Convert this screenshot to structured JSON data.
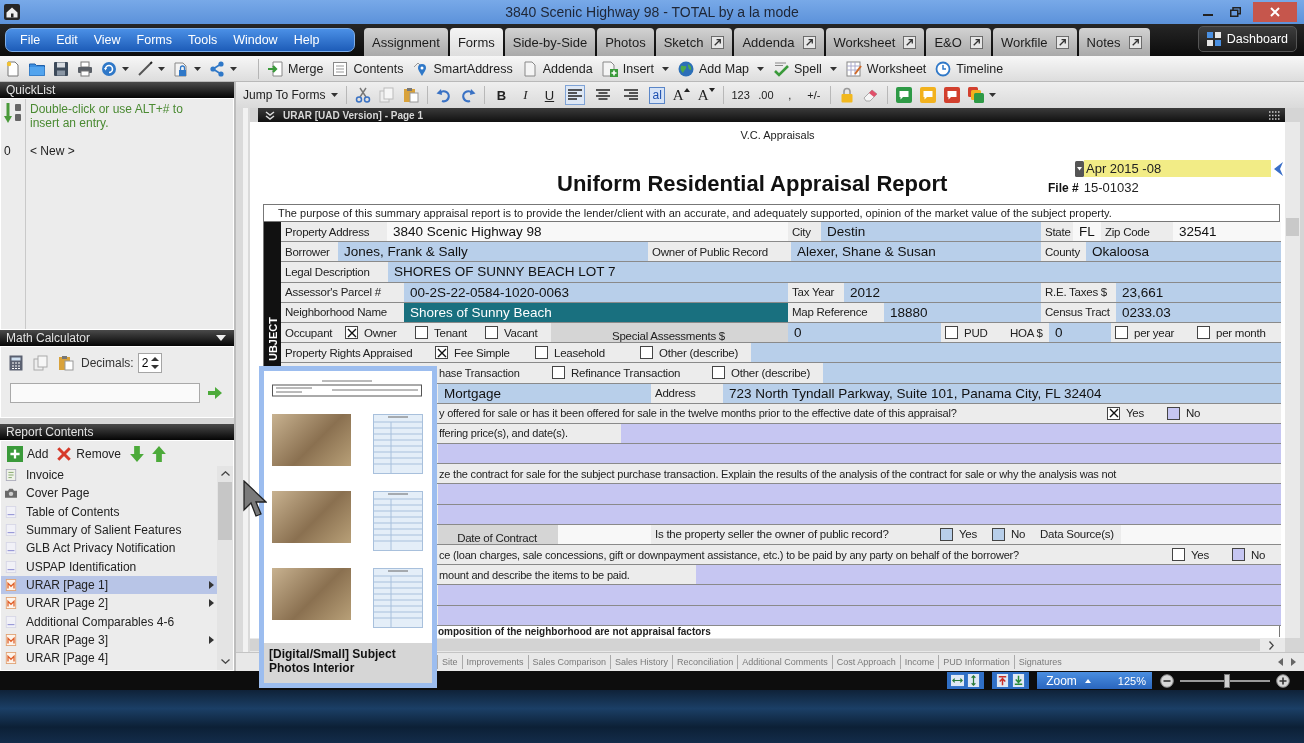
{
  "window": {
    "title": "3840 Scenic Highway 98 - TOTAL by a la mode"
  },
  "menu": [
    "File",
    "Edit",
    "View",
    "Forms",
    "Tools",
    "Window",
    "Help"
  ],
  "tabs": [
    {
      "label": "Assignment",
      "selected": false,
      "popout": false
    },
    {
      "label": "Forms",
      "selected": true,
      "popout": false
    },
    {
      "label": "Side-by-Side",
      "selected": false,
      "popout": false
    },
    {
      "label": "Photos",
      "selected": false,
      "popout": false
    },
    {
      "label": "Sketch",
      "selected": false,
      "popout": true
    },
    {
      "label": "Addenda",
      "selected": false,
      "popout": true
    },
    {
      "label": "Worksheet",
      "selected": false,
      "popout": true
    },
    {
      "label": "E&O",
      "selected": false,
      "popout": true
    },
    {
      "label": "Workfile",
      "selected": false,
      "popout": true
    },
    {
      "label": "Notes",
      "selected": false,
      "popout": true
    }
  ],
  "dashboard": {
    "label": "Dashboard"
  },
  "toolbar": {
    "buttons": [
      {
        "label": "Merge",
        "dropdown": false
      },
      {
        "label": "Contents",
        "dropdown": false
      },
      {
        "label": "SmartAddress",
        "dropdown": false
      },
      {
        "label": "Addenda",
        "dropdown": false
      },
      {
        "label": "Insert",
        "dropdown": true
      },
      {
        "label": "Add Map",
        "dropdown": true
      },
      {
        "label": "Spell",
        "dropdown": true
      },
      {
        "label": "Worksheet",
        "dropdown": false
      },
      {
        "label": "Timeline",
        "dropdown": false
      }
    ]
  },
  "format_toolbar": {
    "jump": "Jump To Forms",
    "styles": [
      "B",
      "I",
      "U"
    ],
    "align": [
      {
        "kind": "left",
        "selected": true
      },
      {
        "kind": "center",
        "selected": false
      },
      {
        "kind": "right",
        "selected": false
      }
    ],
    "font": "al",
    "sizes": [
      {
        "kind": "grow",
        "label": "A"
      },
      {
        "kind": "shrink",
        "label": "A"
      }
    ],
    "numbers": [
      "123",
      ".00",
      ",",
      "+/-"
    ]
  },
  "quicklist": {
    "title": "QuickList",
    "hint": "Double-click or use ALT+# to insert an entry.",
    "entries": [
      {
        "number": "0",
        "text": "< New >"
      }
    ]
  },
  "math_calculator": {
    "title": "Math Calculator",
    "decimals_label": "Decimals:",
    "decimals": "2"
  },
  "report_contents": {
    "title": "Report Contents",
    "add": "Add",
    "remove": "Remove",
    "items": [
      {
        "label": "Invoice",
        "kind": "invoice",
        "selected": false,
        "submenu": false
      },
      {
        "label": "Cover Page",
        "kind": "cover",
        "selected": false,
        "submenu": false
      },
      {
        "label": "Table of Contents",
        "kind": "page",
        "selected": false,
        "submenu": false
      },
      {
        "label": "Summary of Salient Features",
        "kind": "page",
        "selected": false,
        "submenu": false
      },
      {
        "label": "GLB Act Privacy Notification",
        "kind": "page",
        "selected": false,
        "submenu": false
      },
      {
        "label": "USPAP Identification",
        "kind": "page",
        "selected": false,
        "submenu": false
      },
      {
        "label": "URAR [Page 1]",
        "kind": "form",
        "selected": true,
        "submenu": true
      },
      {
        "label": "URAR [Page 2]",
        "kind": "form",
        "selected": false,
        "submenu": true
      },
      {
        "label": "Additional Comparables 4-6",
        "kind": "page",
        "selected": false,
        "submenu": false
      },
      {
        "label": "URAR [Page 3]",
        "kind": "form",
        "selected": false,
        "submenu": true
      },
      {
        "label": "URAR [Page 4]",
        "kind": "form",
        "selected": false,
        "submenu": false
      }
    ]
  },
  "document": {
    "header": "URAR [UAD Version] - Page 1",
    "company": "V.C. Appraisals",
    "date": "Apr 2015 -08",
    "title": "Uniform Residential Appraisal Report",
    "file_label": "File #",
    "file_number": "15-01032",
    "purpose": "The purpose of this summary appraisal report is to provide the lender/client with an accurate, and adequately supported, opinion of the market value of the subject property.",
    "section": "UBJECT",
    "lines": [
      {
        "parts": [
          {
            "kind": "label",
            "text": "Property Address"
          },
          {
            "kind": "value",
            "text": "3840 Scenic Highway 98",
            "selected": false
          },
          {
            "kind": "label",
            "text": "City"
          },
          {
            "kind": "value",
            "text": "Destin",
            "selected": false,
            "color": "#b8cfea"
          },
          {
            "kind": "label",
            "text": "State"
          },
          {
            "kind": "value",
            "text": "FL",
            "selected": false
          },
          {
            "kind": "label",
            "text": "Zip Code"
          },
          {
            "kind": "value",
            "text": "32541",
            "selected": false
          }
        ]
      },
      {
        "parts": [
          {
            "kind": "label",
            "text": "Borrower"
          },
          {
            "kind": "value",
            "text": "Jones, Frank & Sally",
            "selected": false,
            "color": "#b8cfea"
          },
          {
            "kind": "label",
            "text": "Owner of Public Record"
          },
          {
            "kind": "value",
            "text": "Alexer, Shane & Susan",
            "selected": false,
            "color": "#b8cfea"
          },
          {
            "kind": "label",
            "text": "County"
          },
          {
            "kind": "value",
            "text": "Okaloosa",
            "selected": false,
            "color": "#b8cfea"
          }
        ]
      },
      {
        "parts": [
          {
            "kind": "label",
            "text": "Legal Description"
          },
          {
            "kind": "value",
            "text": "SHORES OF SUNNY BEACH LOT 7",
            "selected": false,
            "color": "#b8cfea"
          }
        ]
      },
      {
        "parts": [
          {
            "kind": "label",
            "text": "Assessor's Parcel #"
          },
          {
            "kind": "value",
            "text": "00-2S-22-0584-1020-0063",
            "selected": false,
            "color": "#b8cfea"
          },
          {
            "kind": "label",
            "text": "Tax Year"
          },
          {
            "kind": "value",
            "text": "2012",
            "selected": false,
            "color": "#b8cfea"
          },
          {
            "kind": "label",
            "text": "R.E. Taxes $"
          },
          {
            "kind": "value",
            "text": "23,661",
            "selected": false,
            "color": "#b8cfea"
          }
        ]
      },
      {
        "parts": [
          {
            "kind": "label",
            "text": "Neighborhood Name"
          },
          {
            "kind": "value",
            "text": "Shores of Sunny Beach",
            "selected": true
          },
          {
            "kind": "label",
            "text": "Map Reference"
          },
          {
            "kind": "value",
            "text": "18880",
            "selected": false,
            "color": "#b8cfea"
          },
          {
            "kind": "label",
            "text": "Census Tract"
          },
          {
            "kind": "value",
            "text": "0233.03",
            "selected": false,
            "color": "#b8cfea"
          }
        ]
      },
      {
        "parts": [
          {
            "kind": "label",
            "text": "Occupant"
          },
          {
            "kind": "check",
            "label": "Owner",
            "checked": true
          },
          {
            "kind": "check",
            "label": "Tenant",
            "checked": false
          },
          {
            "kind": "check",
            "label": "Vacant",
            "checked": false
          },
          {
            "kind": "label",
            "text": "Special Assessments $"
          },
          {
            "kind": "value",
            "text": "0",
            "selected": false,
            "color": "#b8cfea"
          },
          {
            "kind": "check",
            "label": "PUD",
            "checked": false
          },
          {
            "kind": "label",
            "text": "HOA $"
          },
          {
            "kind": "value",
            "text": "0",
            "selected": false,
            "color": "#b8cfea"
          },
          {
            "kind": "check",
            "label": "per year",
            "checked": false
          },
          {
            "kind": "check",
            "label": "per month",
            "checked": false
          }
        ]
      },
      {
        "parts": [
          {
            "kind": "label",
            "text": "Property Rights Appraised"
          },
          {
            "kind": "check",
            "label": "Fee Simple",
            "checked": true
          },
          {
            "kind": "check",
            "label": "Leasehold",
            "checked": false
          },
          {
            "kind": "check",
            "label": "Other (describe)",
            "checked": false
          },
          {
            "kind": "field",
            "color": "#b8cfea"
          }
        ]
      },
      {
        "parts": [
          {
            "kind": "text",
            "text": "hase Transaction"
          },
          {
            "kind": "check",
            "label": "Refinance Transaction",
            "checked": false
          },
          {
            "kind": "check",
            "label": "Other (describe)",
            "checked": false
          },
          {
            "kind": "field",
            "color": "#b8cfea"
          }
        ]
      },
      {
        "parts": [
          {
            "kind": "value",
            "text": "Mortgage",
            "selected": false,
            "color": "#b8cfea"
          },
          {
            "kind": "label",
            "text": "Address"
          },
          {
            "kind": "value",
            "text": "723 North Tyndall Parkway, Suite 101, Panama City, FL 32404",
            "selected": false,
            "color": "#b8cfea"
          }
        ]
      },
      {
        "parts": [
          {
            "kind": "text",
            "text": "y offered for sale or has it been offered for sale in the twelve months prior to the effective date of this appraisal?"
          },
          {
            "kind": "check",
            "label": "Yes",
            "checked": true
          },
          {
            "kind": "check",
            "label": "No",
            "checked": false,
            "color": "#c6c6f2"
          }
        ]
      },
      {
        "parts": [
          {
            "kind": "text",
            "text": "ffering price(s), and date(s)."
          },
          {
            "kind": "field",
            "color": "#c6c6f2"
          }
        ]
      },
      {
        "parts": [
          {
            "kind": "field",
            "color": "#c6c6f2"
          }
        ]
      },
      {
        "parts": [
          {
            "kind": "text",
            "text": "ze the contract for sale for the subject purchase transaction. Explain the results of the analysis of the contract for sale or why the analysis was not"
          }
        ]
      },
      {
        "parts": [
          {
            "kind": "field",
            "color": "#c6c6f2"
          }
        ]
      },
      {
        "parts": [
          {
            "kind": "field",
            "color": "#c6c6f2"
          }
        ]
      },
      {
        "parts": [
          {
            "kind": "label",
            "text": "Date of Contract"
          },
          {
            "kind": "field"
          },
          {
            "kind": "label",
            "text": "Is the property seller the owner of public record?"
          },
          {
            "kind": "check",
            "label": "Yes",
            "checked": false,
            "color": "#b8cfea"
          },
          {
            "kind": "check",
            "label": "No",
            "checked": false,
            "color": "#b8cfea"
          },
          {
            "kind": "label",
            "text": "Data Source(s)"
          },
          {
            "kind": "field"
          }
        ]
      },
      {
        "parts": [
          {
            "kind": "text",
            "text": "ce (loan charges, sale concessions, gift or downpayment assistance, etc.) to be paid by any party on behalf of the borrower?"
          },
          {
            "kind": "check",
            "label": "Yes",
            "checked": false
          },
          {
            "kind": "check",
            "label": "No",
            "checked": false,
            "color": "#c6c6f2"
          }
        ]
      },
      {
        "parts": [
          {
            "kind": "text",
            "text": "mount and describe the items to be paid."
          },
          {
            "kind": "field",
            "color": "#c6c6f2"
          }
        ]
      },
      {
        "parts": [
          {
            "kind": "field",
            "color": "#c6c6f2"
          }
        ]
      },
      {
        "parts": [
          {
            "kind": "field",
            "color": "#c6c6f2"
          }
        ]
      }
    ],
    "cut_line": "omposition of the neighborhood are not appraisal factors",
    "tabs": [
      "Site",
      "Improvements",
      "Sales Comparison",
      "Sales History",
      "Reconciliation",
      "Additional Comments",
      "Cost Approach",
      "Income",
      "PUD Information",
      "Signatures"
    ]
  },
  "thumbnail_popup": {
    "caption": "[Digital/Small] Subject Photos Interior"
  },
  "zoom": {
    "label": "Zoom",
    "value": "125%",
    "level": 0.52
  }
}
